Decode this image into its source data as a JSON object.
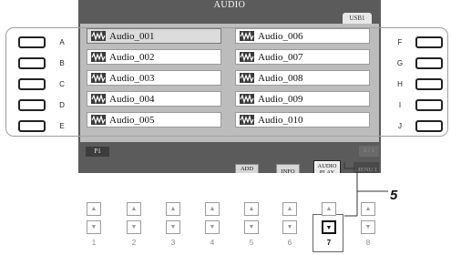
{
  "screen": {
    "title": "AUDIO",
    "device_tab": "USB1",
    "page_indicator": "P1",
    "right_indicator": "1 / 1",
    "files": [
      {
        "name": "Audio_001",
        "selected": true
      },
      {
        "name": "Audio_002",
        "selected": false
      },
      {
        "name": "Audio_003",
        "selected": false
      },
      {
        "name": "Audio_004",
        "selected": false
      },
      {
        "name": "Audio_005",
        "selected": false
      },
      {
        "name": "Audio_006",
        "selected": false
      },
      {
        "name": "Audio_007",
        "selected": false
      },
      {
        "name": "Audio_008",
        "selected": false
      },
      {
        "name": "Audio_009",
        "selected": false
      },
      {
        "name": "Audio_010",
        "selected": false
      }
    ],
    "file_icon": "waveform-icon",
    "soft_buttons": {
      "add_to_mp": "ADD TO MP",
      "info": "INFO",
      "audio_play": "AUDIO PLAY",
      "menu": "MENU 1"
    }
  },
  "side_buttons": {
    "left": [
      "A",
      "B",
      "C",
      "D",
      "E"
    ],
    "right": [
      "F",
      "G",
      "H",
      "I",
      "J"
    ]
  },
  "lower_buttons": {
    "numbers": [
      "1",
      "2",
      "3",
      "4",
      "5",
      "6",
      "7",
      "8"
    ],
    "up_icon": "▲",
    "down_icon": "▼",
    "highlighted": "7"
  },
  "callout": "5",
  "colors": {
    "screen_bg": "#5b5b5b",
    "list_bg": "#bcbcbc",
    "selected_file": "#dcdcdc"
  }
}
